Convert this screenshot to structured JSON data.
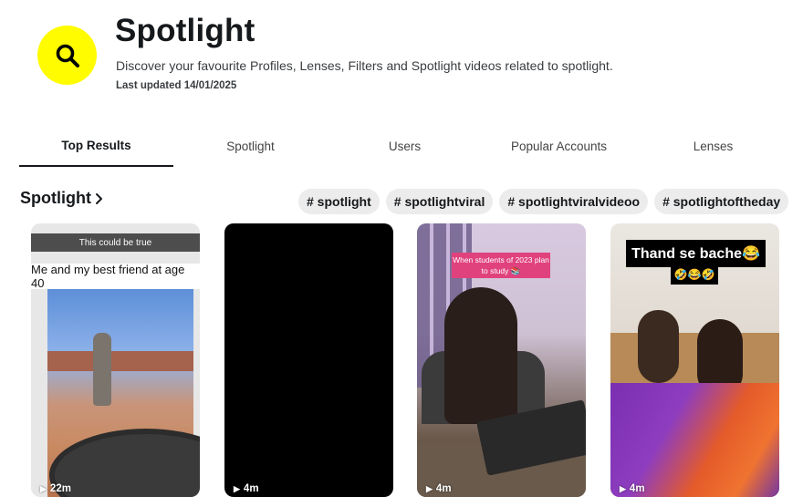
{
  "header": {
    "title": "Spotlight",
    "subtitle": "Discover your favourite Profiles, Lenses, Filters and Spotlight videos related to spotlight.",
    "updated": "Last updated 14/01/2025",
    "search_icon": "search-icon",
    "accent_color": "#fffc00"
  },
  "tabs": [
    {
      "label": "Top Results",
      "active": true
    },
    {
      "label": "Spotlight",
      "active": false
    },
    {
      "label": "Users",
      "active": false
    },
    {
      "label": "Popular Accounts",
      "active": false
    },
    {
      "label": "Lenses",
      "active": false
    }
  ],
  "section": {
    "title": "Spotlight",
    "chevron_icon": "chevron-right-icon"
  },
  "hashtags": [
    "# spotlight",
    "# spotlightviral",
    "# spotlightviralvideoo",
    "# spotlightoftheday"
  ],
  "videos": [
    {
      "duration": "22m",
      "top_text": "This could be true",
      "caption": "Me and my best friend at age 40"
    },
    {
      "duration": "4m"
    },
    {
      "duration": "4m",
      "tag_text": "When students of 2023 plan to study 📚"
    },
    {
      "duration": "4m",
      "caption": "Thand se bache😂",
      "emoji_line": "🤣😂🤣"
    }
  ]
}
